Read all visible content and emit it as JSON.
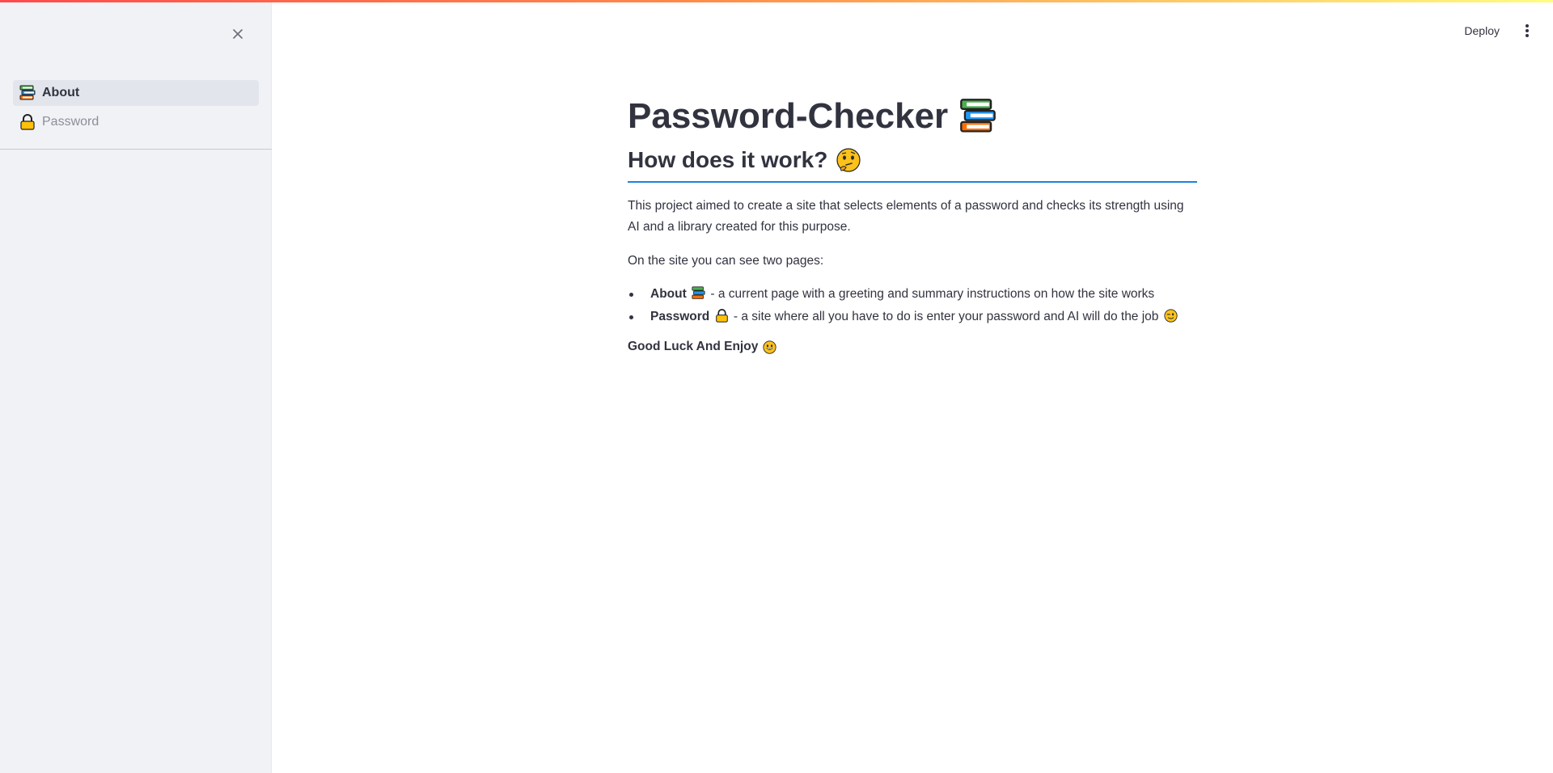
{
  "sidebar": {
    "close_icon": "close-icon",
    "items": [
      {
        "label": "About",
        "icon": "books-icon",
        "active": true
      },
      {
        "label": "Password",
        "icon": "lock-icon",
        "active": false
      }
    ]
  },
  "header": {
    "deploy_label": "Deploy",
    "menu_icon": "kebab-menu-icon"
  },
  "main": {
    "title": "Password-Checker",
    "title_icon": "books-icon",
    "subheader": "How does it work?",
    "subheader_icon": "thinking-face-icon",
    "paragraph1": "This project aimed to create a site that selects elements of a password and checks its strength using AI and a library created for this purpose.",
    "paragraph2": "On the site you can see two pages:",
    "list": [
      {
        "name": "About",
        "icon": "books-icon",
        "text": " - a current page with a greeting and summary instructions on how the site works"
      },
      {
        "name": "Password",
        "icon": "lock-icon",
        "text": " - a site where all you have to do is enter your password and AI will do the job",
        "trail_icon": "winking-face-icon"
      }
    ],
    "closing": "Good Luck And Enjoy",
    "closing_icon": "grinning-face-icon"
  },
  "colors": {
    "sidebar_bg": "#f0f2f6",
    "accent_blue": "#1c83e1",
    "text": "#31333f",
    "muted": "#8c8f99"
  }
}
